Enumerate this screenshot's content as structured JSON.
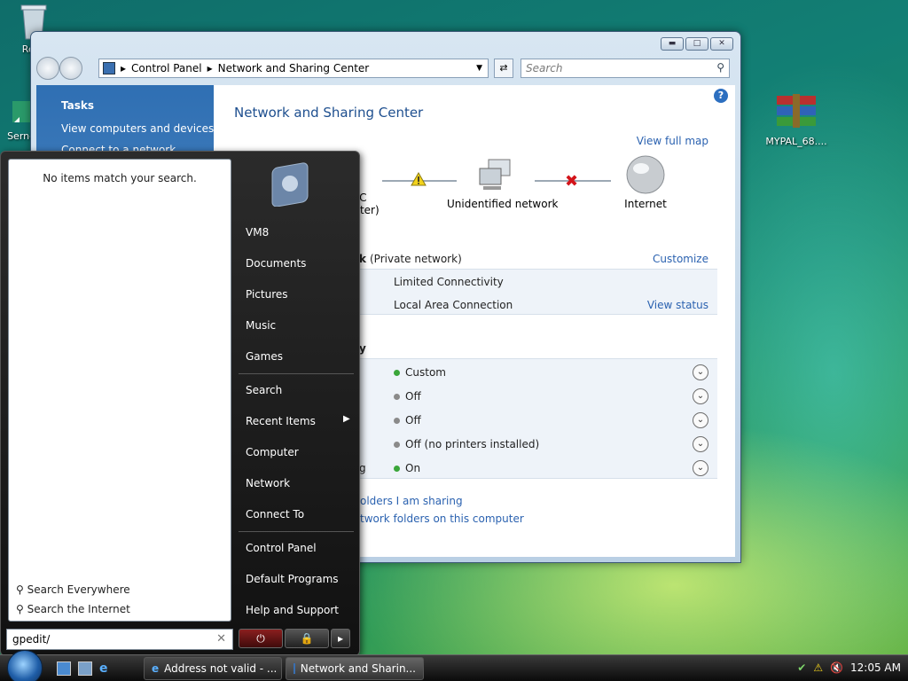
{
  "desktop": {
    "recycle_label": "Recy",
    "serene_label": "Serne",
    "winrar_label": "MYPAL_68...."
  },
  "explorer": {
    "breadcrumb": [
      "Control Panel",
      "Network and Sharing Center"
    ],
    "search_placeholder": "Search",
    "tasks_title": "Tasks",
    "tasks": [
      "View computers and devices",
      "Connect to a network"
    ],
    "page_title": "Network and Sharing Center",
    "view_full_map": "View full map",
    "map": {
      "computer_line1": "C",
      "computer_line2": "outer)",
      "network_label": "Unidentified network",
      "internet_label": "Internet"
    },
    "network_head": "k",
    "network_type": "(Private network)",
    "customize": "Customize",
    "access_value": "Limited Connectivity",
    "connection_value": "Local Area Connection",
    "view_status": "View status",
    "sharing_head": "y",
    "sharing": [
      {
        "label": "",
        "status": "Custom",
        "color": "#3aa63a"
      },
      {
        "label": "",
        "status": "Off",
        "color": "#8a8a8a"
      },
      {
        "label": "",
        "status": "Off",
        "color": "#8a8a8a"
      },
      {
        "label": "",
        "status": "Off (no printers installed)",
        "color": "#8a8a8a"
      },
      {
        "label": "g",
        "status": "On",
        "color": "#3aa63a"
      }
    ],
    "link_folders_sharing": "olders I am sharing",
    "link_network_folders": "twork folders on this computer"
  },
  "start_menu": {
    "no_items": "No items match your search.",
    "search_everywhere": "Search Everywhere",
    "search_internet": "Search the Internet",
    "search_value": "gpedit/",
    "items": [
      "VM8",
      "Documents",
      "Pictures",
      "Music",
      "Games",
      "Search",
      "Recent Items",
      "Computer",
      "Network",
      "Connect To",
      "Control Panel",
      "Default Programs",
      "Help and Support"
    ]
  },
  "taskbar": {
    "buttons": [
      "Address not valid - ...",
      "Network and Sharin..."
    ],
    "clock": "12:05 AM"
  }
}
